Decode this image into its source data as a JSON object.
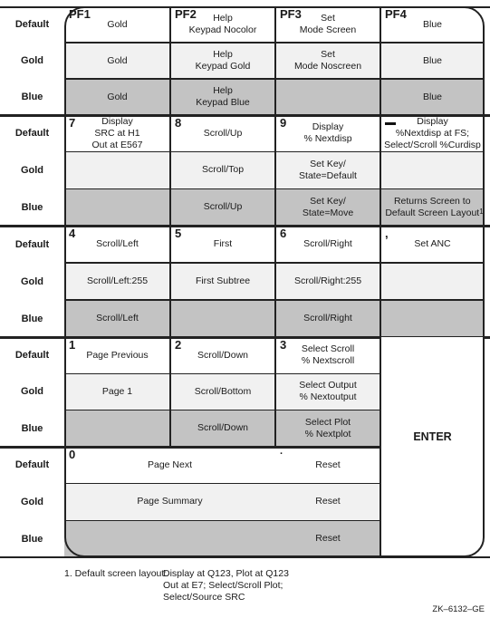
{
  "row_labels": [
    "Default",
    "Gold",
    "Blue"
  ],
  "groups": [
    {
      "keys": [
        {
          "key": "PF1",
          "default": "Gold",
          "gold": "Gold",
          "blue": "Gold"
        },
        {
          "key": "PF2",
          "default": "Help\nKeypad Nocolor",
          "gold": "Help\nKeypad Gold",
          "blue": "Help\nKeypad Blue"
        },
        {
          "key": "PF3",
          "default": "Set\nMode Screen",
          "gold": "Set\nMode Noscreen",
          "blue": ""
        },
        {
          "key": "PF4",
          "default": "Blue",
          "gold": "Blue",
          "blue": "Blue"
        }
      ]
    },
    {
      "keys": [
        {
          "key": "7",
          "default": "Display\nSRC at H1\nOut at E567",
          "gold": "",
          "blue": ""
        },
        {
          "key": "8",
          "default": "Scroll/Up",
          "gold": "Scroll/Top",
          "blue": "Scroll/Up"
        },
        {
          "key": "9",
          "default": "Display\n% Nextdisp",
          "gold": "Set Key/\nState=Default",
          "blue": "Set Key/\nState=Move"
        },
        {
          "key": "–",
          "default": "Display\n%Nextdisp at FS;\nSelect/Scroll %Curdisp",
          "gold": "",
          "blue": "Returns Screen to\nDefault Screen Layout",
          "blue_superscript": "1"
        }
      ]
    },
    {
      "keys": [
        {
          "key": "4",
          "default": "Scroll/Left",
          "gold": "Scroll/Left:255",
          "blue": "Scroll/Left"
        },
        {
          "key": "5",
          "default": "First",
          "gold": "First Subtree",
          "blue": ""
        },
        {
          "key": "6",
          "default": "Scroll/Right",
          "gold": "Scroll/Right:255",
          "blue": "Scroll/Right"
        },
        {
          "key": ",",
          "default": "Set ANC",
          "gold": "",
          "blue": ""
        }
      ]
    },
    {
      "keys": [
        {
          "key": "1",
          "default": "Page Previous",
          "gold": "Page 1",
          "blue": ""
        },
        {
          "key": "2",
          "default": "Scroll/Down",
          "gold": "Scroll/Bottom",
          "blue": "Scroll/Down"
        },
        {
          "key": "3",
          "default": "Select Scroll\n% Nextscroll",
          "gold": "Select Output\n% Nextoutput",
          "blue": "Select Plot\n% Nextplot"
        }
      ]
    },
    {
      "keys": [
        {
          "key": "0",
          "default": "Page Next",
          "gold": "Page Summary",
          "blue": ""
        },
        {
          "key": ".",
          "default": "Reset",
          "gold": "Reset",
          "blue": "Reset"
        }
      ]
    }
  ],
  "enter_key": {
    "label": "ENTER"
  },
  "footnote": {
    "marker": "1. Default screen layout:",
    "lines": [
      "Display at Q123, Plot at Q123",
      "Out at E7; Select/Scroll Plot;",
      "Select/Source SRC"
    ]
  },
  "figure_id": "ZK–6132–GE"
}
